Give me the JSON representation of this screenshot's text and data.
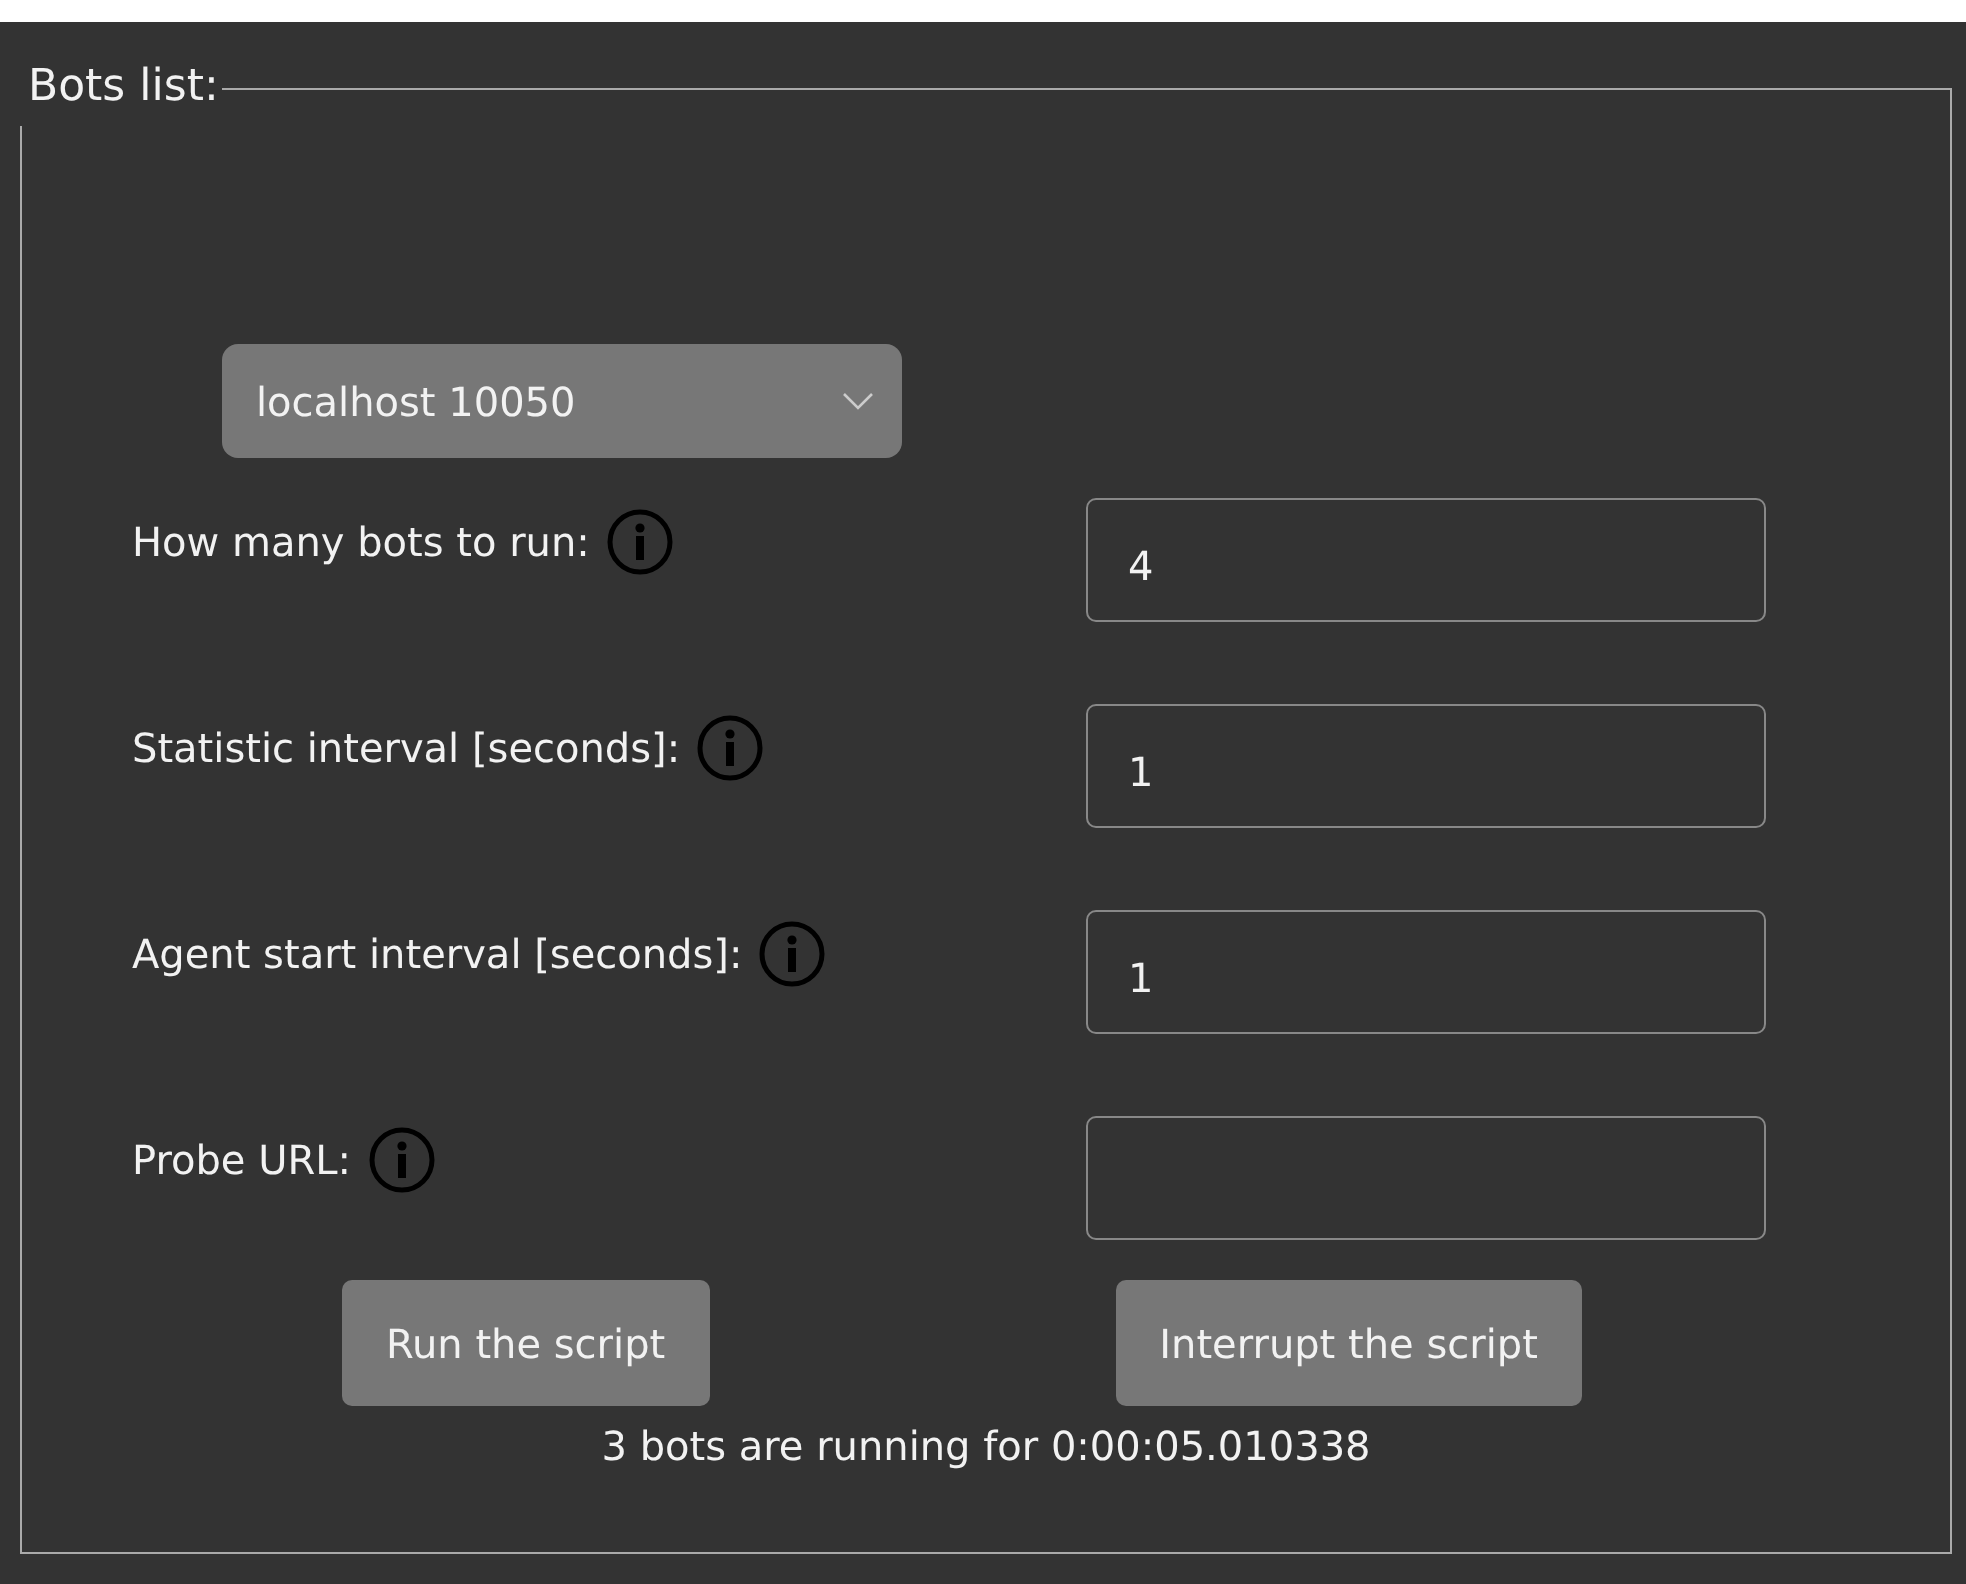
{
  "panel": {
    "title": "Bots list:"
  },
  "server_select": {
    "value": "localhost 10050"
  },
  "fields": [
    {
      "label": "How many bots to run:",
      "value": "4"
    },
    {
      "label": "Statistic interval [seconds]:",
      "value": "1"
    },
    {
      "label": "Agent start interval [seconds]:",
      "value": "1"
    },
    {
      "label": "Probe URL:"
    }
  ],
  "buttons": [
    "Run the script",
    "Interrupt the script"
  ],
  "status": "3 bots are running for 0:00:05.010338"
}
